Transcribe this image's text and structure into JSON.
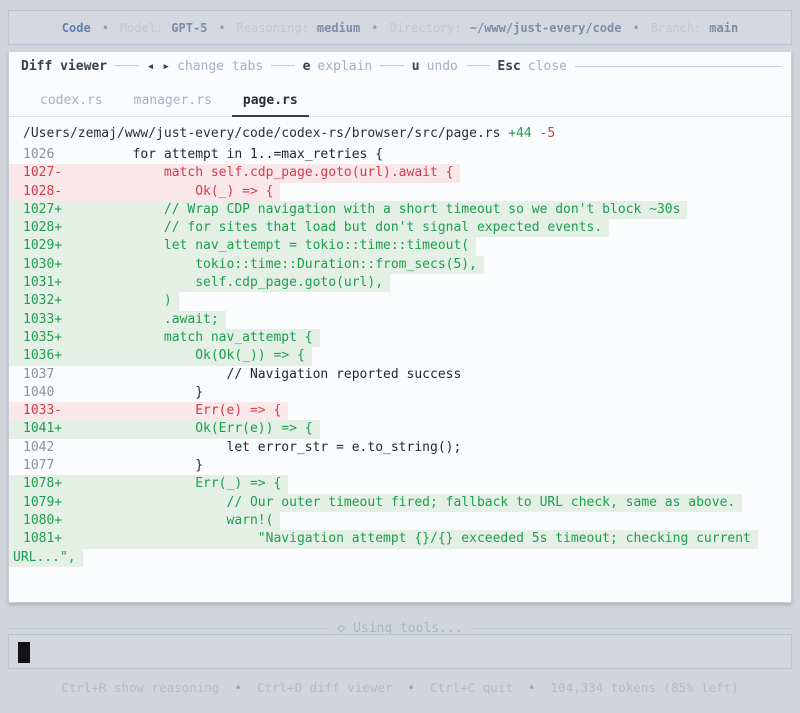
{
  "top_bar": {
    "app": "Code",
    "separator": "•",
    "items": [
      {
        "label": "Model:",
        "value": "GPT-5"
      },
      {
        "label": "Reasoning:",
        "value": "medium"
      },
      {
        "label": "Directory:",
        "value": "~/www/just-every/code"
      },
      {
        "label": "Branch:",
        "value": "main"
      }
    ]
  },
  "diff_viewer": {
    "title": "Diff viewer",
    "separator": "───",
    "hints": [
      {
        "key": "◂ ▸",
        "label": "change tabs"
      },
      {
        "key": "e",
        "label": "explain"
      },
      {
        "key": "u",
        "label": "undo"
      },
      {
        "key": "Esc",
        "label": "close"
      }
    ],
    "tabs": [
      {
        "label": "codex.rs",
        "active": false
      },
      {
        "label": "manager.rs",
        "active": false
      },
      {
        "label": "page.rs",
        "active": true
      }
    ],
    "file": {
      "path": "/Users/zemaj/www/just-every/code/codex-rs/browser/src/page.rs",
      "additions": "+44",
      "deletions": "-5"
    },
    "lines": [
      {
        "num": "1026",
        "sign": "",
        "type": "ctx",
        "code": "        for attempt in 1..=max_retries {"
      },
      {
        "num": "1027",
        "sign": "-",
        "type": "del",
        "code": "            match self.cdp_page.goto(url).await {"
      },
      {
        "num": "1028",
        "sign": "-",
        "type": "del",
        "code": "                Ok(_) => {"
      },
      {
        "num": "1027",
        "sign": "+",
        "type": "add",
        "code": "            // Wrap CDP navigation with a short timeout so we don't block ~30s"
      },
      {
        "num": "1028",
        "sign": "+",
        "type": "add",
        "code": "            // for sites that load but don't signal expected events."
      },
      {
        "num": "1029",
        "sign": "+",
        "type": "add",
        "code": "            let nav_attempt = tokio::time::timeout("
      },
      {
        "num": "1030",
        "sign": "+",
        "type": "add",
        "code": "                tokio::time::Duration::from_secs(5),"
      },
      {
        "num": "1031",
        "sign": "+",
        "type": "add",
        "code": "                self.cdp_page.goto(url),"
      },
      {
        "num": "1032",
        "sign": "+",
        "type": "add",
        "code": "            )"
      },
      {
        "num": "1033",
        "sign": "+",
        "type": "add",
        "code": "            .await;"
      },
      {
        "num": "1035",
        "sign": "+",
        "type": "add",
        "code": "            match nav_attempt {"
      },
      {
        "num": "1036",
        "sign": "+",
        "type": "add",
        "code": "                Ok(Ok(_)) => {"
      },
      {
        "num": "1037",
        "sign": "",
        "type": "ctx",
        "code": "                    // Navigation reported success"
      },
      {
        "num": "1040",
        "sign": "",
        "type": "ctx",
        "code": "                }"
      },
      {
        "num": "1033",
        "sign": "-",
        "type": "del",
        "code": "                Err(e) => {"
      },
      {
        "num": "1041",
        "sign": "+",
        "type": "add",
        "code": "                Ok(Err(e)) => {"
      },
      {
        "num": "1042",
        "sign": "",
        "type": "ctx",
        "code": "                    let error_str = e.to_string();"
      },
      {
        "num": "1077",
        "sign": "",
        "type": "ctx",
        "code": "                }"
      },
      {
        "num": "1078",
        "sign": "+",
        "type": "add",
        "code": "                Err(_) => {"
      },
      {
        "num": "1079",
        "sign": "+",
        "type": "add",
        "code": "                    // Our outer timeout fired; fallback to URL check, same as above."
      },
      {
        "num": "1080",
        "sign": "+",
        "type": "add",
        "code": "                    warn!("
      },
      {
        "num": "1081",
        "sign": "+",
        "type": "add",
        "code": "                        \"Navigation attempt {}/{} exceeded 5s timeout; checking current"
      },
      {
        "num": "",
        "sign": "",
        "type": "add",
        "cont": true,
        "code": "URL...\","
      }
    ]
  },
  "status": {
    "text": "◇ Using tools..."
  },
  "input": {
    "value": ""
  },
  "footer": {
    "separator": "•",
    "items": [
      "Ctrl+R show reasoning",
      "Ctrl+D diff viewer",
      "Ctrl+C quit",
      "104,334 tokens (85% left)"
    ]
  },
  "colors": {
    "page_bg": "#d1d5db",
    "panel_bg": "#fbfcfd",
    "added_text": "#1e9e4f",
    "added_bg": "#e4efe6",
    "removed_text": "#d23c4c",
    "removed_bg": "#fae7ea",
    "context_text": "#222931",
    "line_number": "#8b929b",
    "muted_blue": "#a8b5cb",
    "value_blue": "#7c8ca9",
    "cursor": "#131313"
  }
}
